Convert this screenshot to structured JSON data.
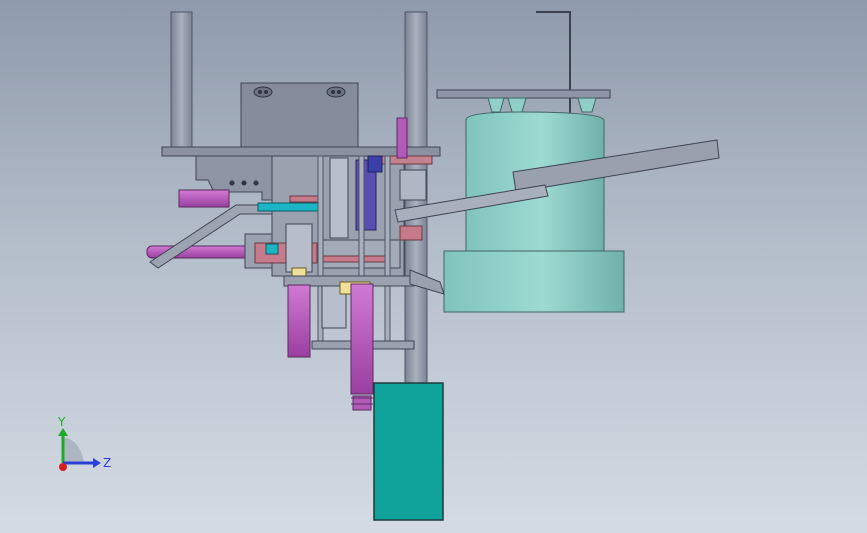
{
  "triad": {
    "y_label": "Y",
    "z_label": "Z",
    "colors": {
      "y": "#1fa82a",
      "z": "#2b3fd6",
      "x": "#d21f1f"
    }
  },
  "colors": {
    "background_top": "#8f9aaa",
    "background_bottom": "#d4dbe4",
    "steel": "#8e95a6",
    "steel_light": "#a7aebc",
    "plate": "#7f8696",
    "magenta": "#b45ab8",
    "bowl": "#8fcfc7",
    "base_block": "#0fa39b",
    "accent_pink": "#c77a8a",
    "accent_blue": "#3a3aa0",
    "accent_cyan": "#1bb5c6"
  }
}
